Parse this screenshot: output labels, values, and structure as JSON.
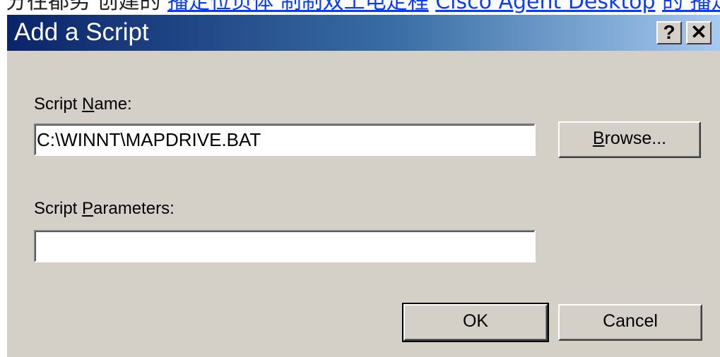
{
  "background_text": {
    "prefix": "分往都劣 创建的",
    "link1": "播定位页体 制制双工电定程",
    "link2": "Cisco Agent Desktop",
    "link3": "的 播定"
  },
  "dialog": {
    "title": "Add a Script",
    "help_label": "?",
    "close_label": "✕"
  },
  "script_name": {
    "label_pre": "Script ",
    "label_key": "N",
    "label_post": "ame:",
    "value": "C:\\WINNT\\MAPDRIVE.BAT"
  },
  "browse_button": {
    "key": "B",
    "rest": "rowse..."
  },
  "script_parameters": {
    "label_pre": "Script ",
    "label_key": "P",
    "label_post": "arameters:",
    "value": ""
  },
  "ok_button": {
    "label": "OK"
  },
  "cancel_button": {
    "label": "Cancel"
  }
}
